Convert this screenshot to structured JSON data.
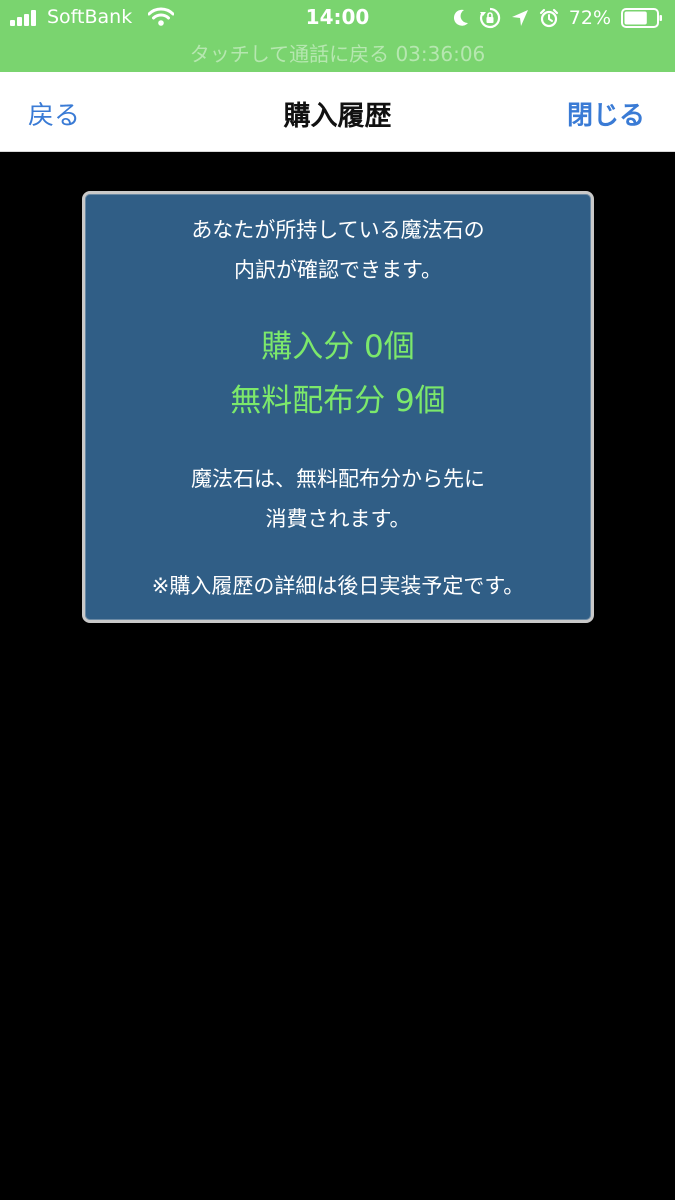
{
  "status_bar": {
    "carrier": "SoftBank",
    "time": "14:00",
    "battery_percent": "72%",
    "battery_level": 0.72,
    "icons": [
      "signal-icon",
      "wifi-icon",
      "moon-icon",
      "rotation-lock-icon",
      "location-icon",
      "alarm-icon",
      "battery-icon"
    ],
    "call_banner": "タッチして通話に戻る 03:36:06",
    "background_color": "#7ad46f"
  },
  "nav": {
    "back_label": "戻る",
    "title": "購入履歴",
    "close_label": "閉じる",
    "accent_color": "#3a7bd5"
  },
  "panel": {
    "intro_line1": "あなたが所持している魔法石の",
    "intro_line2": "内訳が確認できます。",
    "purchased": "購入分 0個",
    "free": "無料配布分 9個",
    "note_line1": "魔法石は、無料配布分から先に",
    "note_line2": "消費されます。",
    "footnote": "※購入履歴の詳細は後日実装予定です。",
    "background_color": "#305e86",
    "highlight_color": "#7ce86b"
  }
}
